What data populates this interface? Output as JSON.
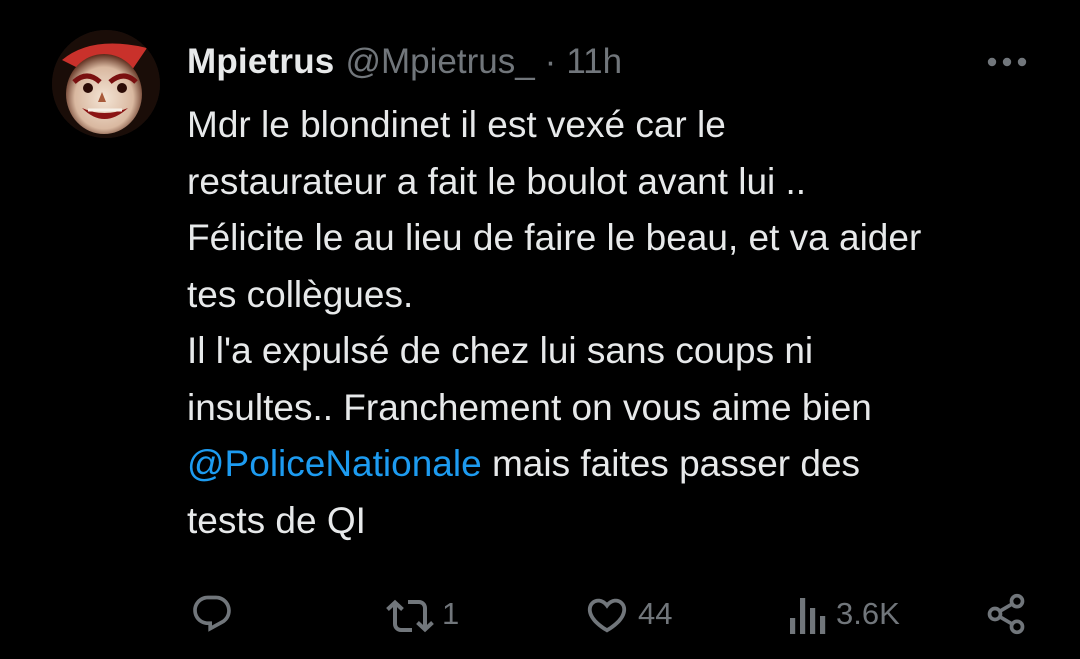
{
  "author": {
    "display_name": "Mpietrus",
    "handle": "@Mpietrus_",
    "separator": "·",
    "time": "11h"
  },
  "more_menu": {
    "icon": "more-horizontal-icon"
  },
  "tweet": {
    "lines": [
      "Mdr le blondinet il est vexé car le",
      "restaurateur a fait le boulot avant lui ..",
      "Félicite le au lieu de faire le beau, et va aider",
      "tes collègues.",
      "Il l'a expulsé de chez lui sans coups ni",
      "insultes.. Franchement on vous aime bien"
    ],
    "mention": "@PoliceNationale",
    "after_mention": " mais faites passer des",
    "last_line": "tests de QI"
  },
  "actions": {
    "reply": {
      "icon": "reply-icon",
      "count": ""
    },
    "retweet": {
      "icon": "retweet-icon",
      "count": "1"
    },
    "like": {
      "icon": "heart-icon",
      "count": "44"
    },
    "views": {
      "icon": "views-icon",
      "count": "3.6K"
    },
    "share": {
      "icon": "share-icon"
    }
  },
  "colors": {
    "background": "#000000",
    "text_primary": "#e7e9ea",
    "text_secondary": "#71767b",
    "link": "#1d9bf0"
  }
}
